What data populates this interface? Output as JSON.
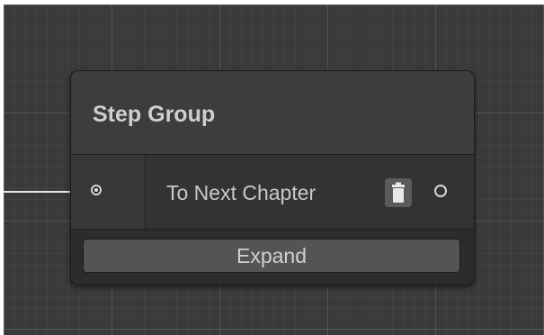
{
  "node": {
    "title": "Step Group",
    "output": {
      "label": "To Next Chapter",
      "delete_icon": "trash-icon"
    },
    "expand_label": "Expand"
  },
  "colors": {
    "canvas_bg": "#3a3a3a",
    "node_header": "#3d3d3d",
    "node_body": "#2c2c2c",
    "port_stroke": "#d8d8d8",
    "button_bg": "#545454"
  }
}
